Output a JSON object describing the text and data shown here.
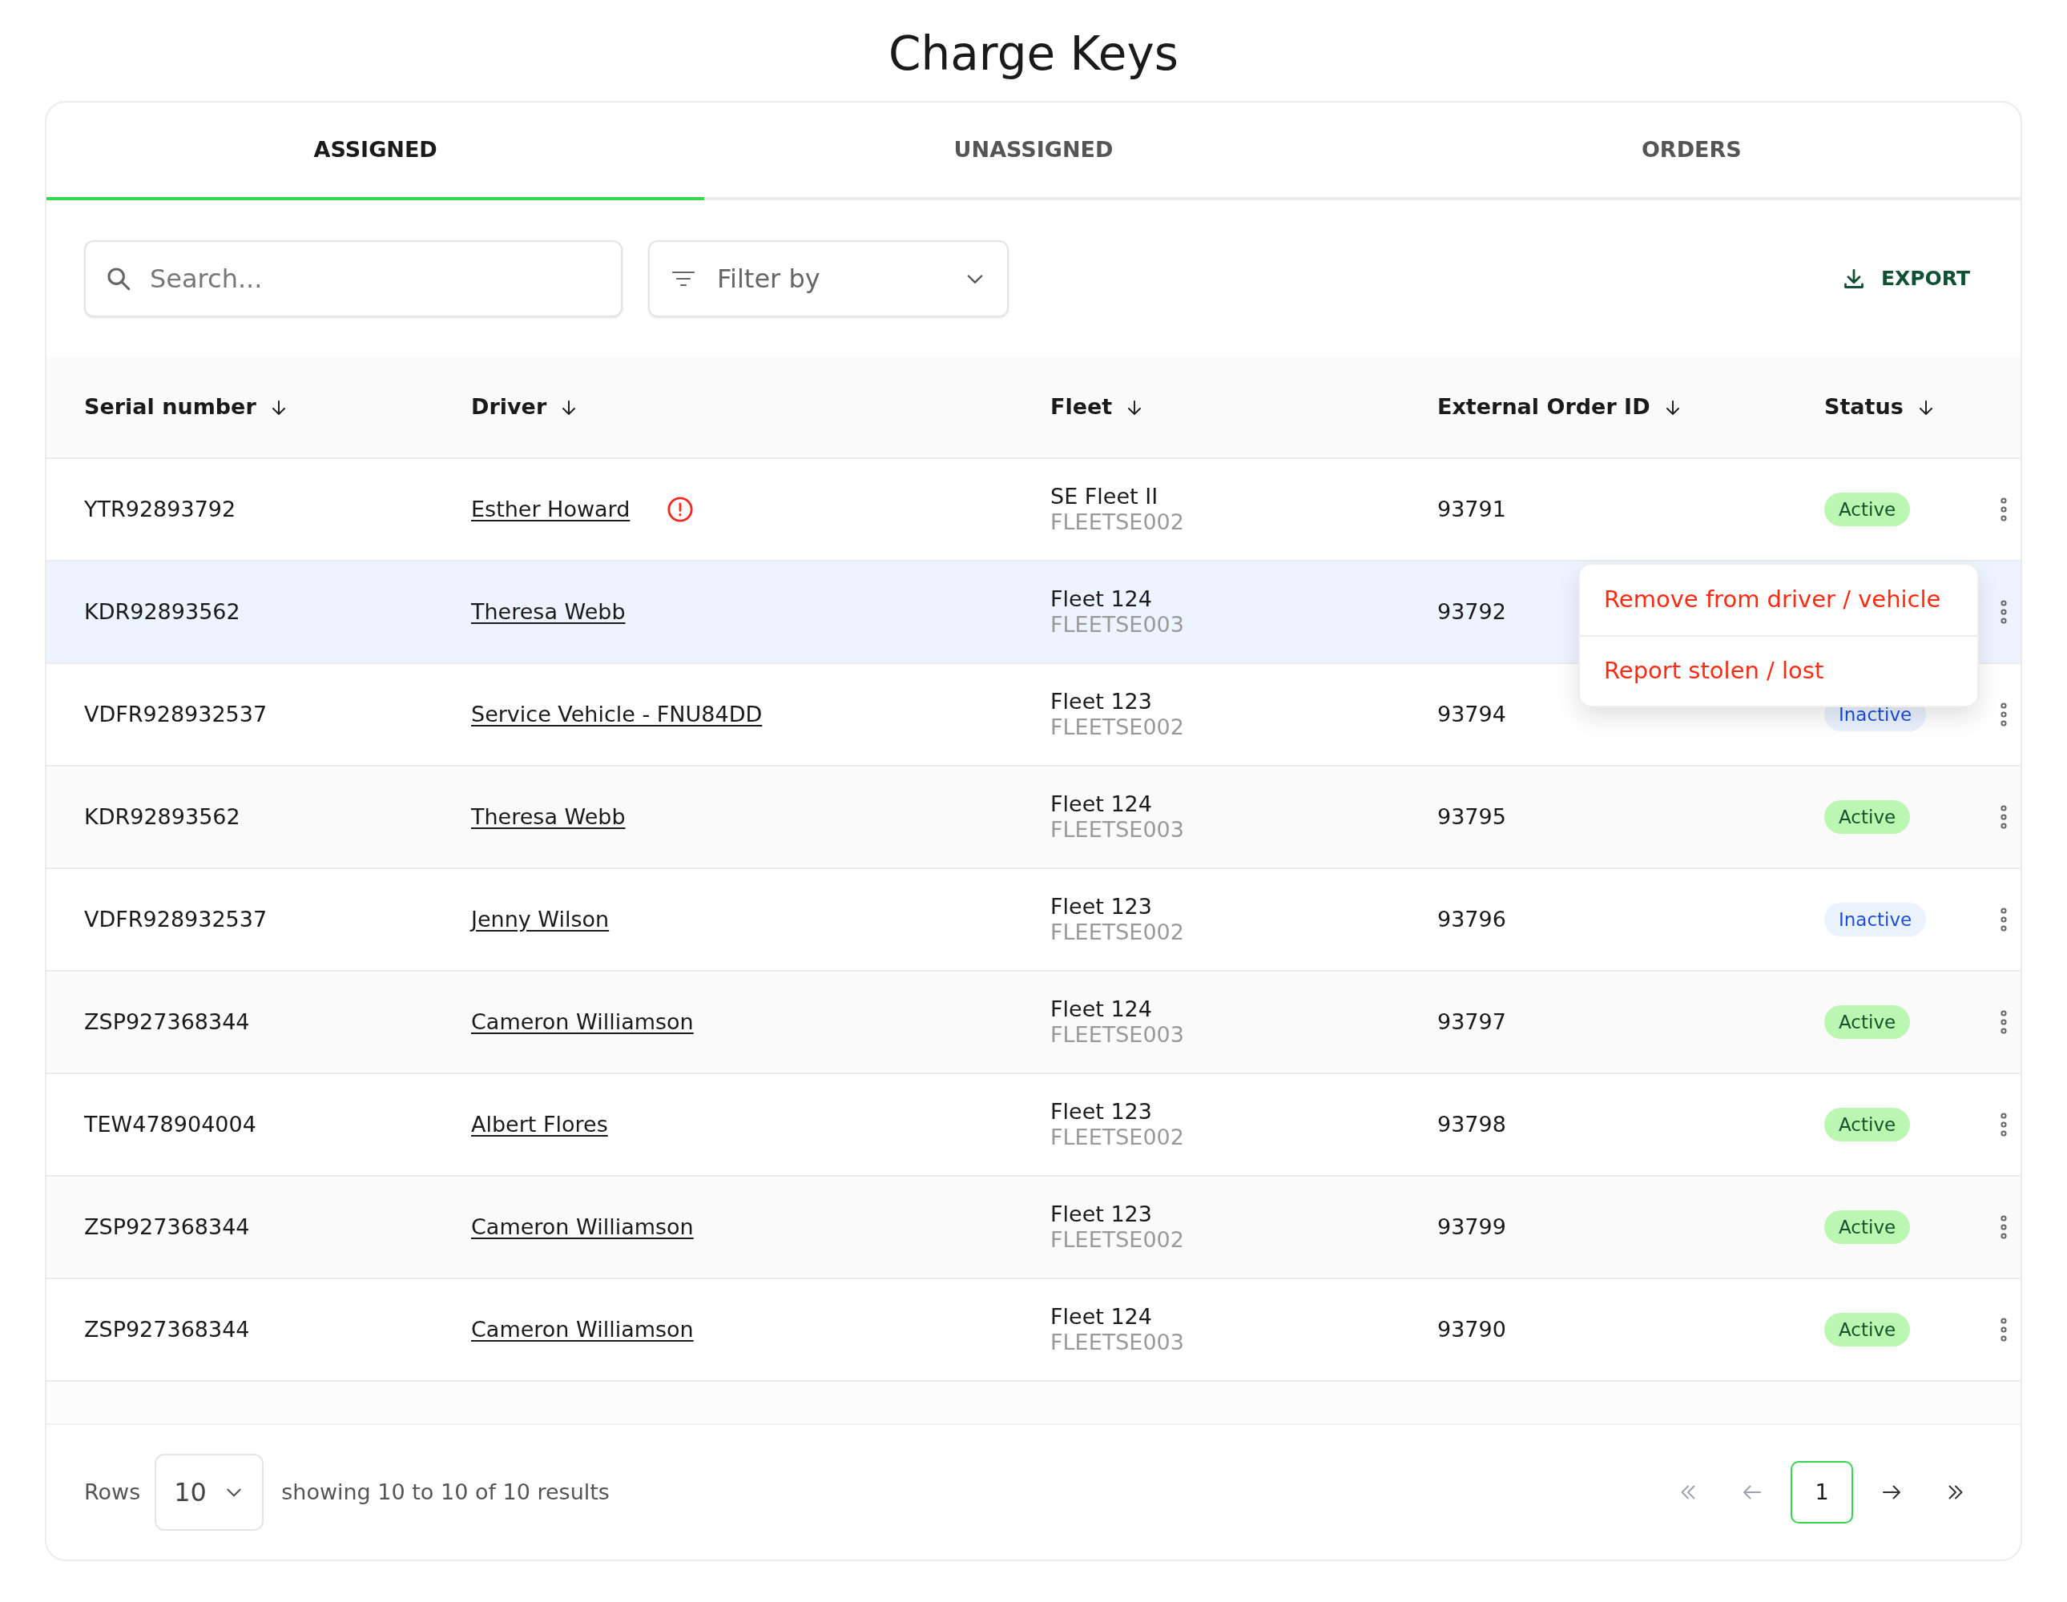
{
  "page_title": "Charge Keys",
  "tabs": [
    {
      "label": "ASSIGNED",
      "selected": true
    },
    {
      "label": "UNASSIGNED",
      "selected": false
    },
    {
      "label": "ORDERS",
      "selected": false
    }
  ],
  "toolbar": {
    "search": {
      "placeholder": "Search..."
    },
    "filter": {
      "placeholder": "Filter by"
    },
    "export": {
      "label": "EXPORT"
    }
  },
  "table": {
    "columns": [
      "Serial number",
      "Driver",
      "Fleet",
      "External Order ID",
      "Status"
    ],
    "rows": [
      {
        "serial": "YTR92893792",
        "driver": "Esther Howard",
        "alert": true,
        "fleet": "SE Fleet II",
        "fleet_code": "FLEETSE002",
        "order_id": "93791",
        "status": {
          "label": "Active",
          "kind": "active"
        },
        "selected": false,
        "menu_open": false
      },
      {
        "serial": "KDR92893562",
        "driver": "Theresa Webb",
        "alert": false,
        "fleet": "Fleet 124",
        "fleet_code": "FLEETSE003",
        "order_id": "93792",
        "selected": true,
        "menu_open": true
      },
      {
        "serial": "VDFR928932537",
        "driver": "Service Vehicle - FNU84DD",
        "alert": false,
        "fleet": "Fleet 123",
        "fleet_code": "FLEETSE002",
        "order_id": "93794",
        "status": {
          "label": "Inactive",
          "kind": "inactive"
        },
        "selected": false,
        "menu_open": false
      },
      {
        "serial": "KDR92893562",
        "driver": "Theresa Webb",
        "alert": false,
        "fleet": "Fleet 124",
        "fleet_code": "FLEETSE003",
        "order_id": "93795",
        "status": {
          "label": "Active",
          "kind": "active"
        },
        "selected": false,
        "menu_open": false
      },
      {
        "serial": "VDFR928932537",
        "driver": "Jenny Wilson",
        "alert": false,
        "fleet": "Fleet 123",
        "fleet_code": "FLEETSE002",
        "order_id": "93796",
        "status": {
          "label": "Inactive",
          "kind": "inactive"
        },
        "selected": false,
        "menu_open": false
      },
      {
        "serial": "ZSP927368344",
        "driver": "Cameron Williamson",
        "alert": false,
        "fleet": "Fleet 124",
        "fleet_code": "FLEETSE003",
        "order_id": "93797",
        "status": {
          "label": "Active",
          "kind": "active"
        },
        "selected": false,
        "menu_open": false
      },
      {
        "serial": "TEW478904004",
        "driver": "Albert Flores",
        "alert": false,
        "fleet": "Fleet 123",
        "fleet_code": "FLEETSE002",
        "order_id": "93798",
        "status": {
          "label": "Active",
          "kind": "active"
        },
        "selected": false,
        "menu_open": false
      },
      {
        "serial": "ZSP927368344",
        "driver": "Cameron Williamson",
        "alert": false,
        "fleet": "Fleet 123",
        "fleet_code": "FLEETSE002",
        "order_id": "93799",
        "status": {
          "label": "Active",
          "kind": "active"
        },
        "selected": false,
        "menu_open": false
      },
      {
        "serial": "ZSP927368344",
        "driver": "Cameron Williamson",
        "alert": false,
        "fleet": "Fleet 124",
        "fleet_code": "FLEETSE003",
        "order_id": "93790",
        "status": {
          "label": "Active",
          "kind": "active"
        },
        "selected": false,
        "menu_open": false
      }
    ],
    "row_menu": [
      "Remove from driver / vehicle",
      "Report stolen / lost"
    ]
  },
  "footer": {
    "rows_label": "Rows",
    "rows_value": "10",
    "summary": "showing 10 to 10 of 10 results",
    "pagination": {
      "first_disabled": true,
      "prev_disabled": true,
      "pages": [
        {
          "label": "1",
          "selected": true
        }
      ],
      "next_disabled": false,
      "last_disabled": false
    }
  }
}
